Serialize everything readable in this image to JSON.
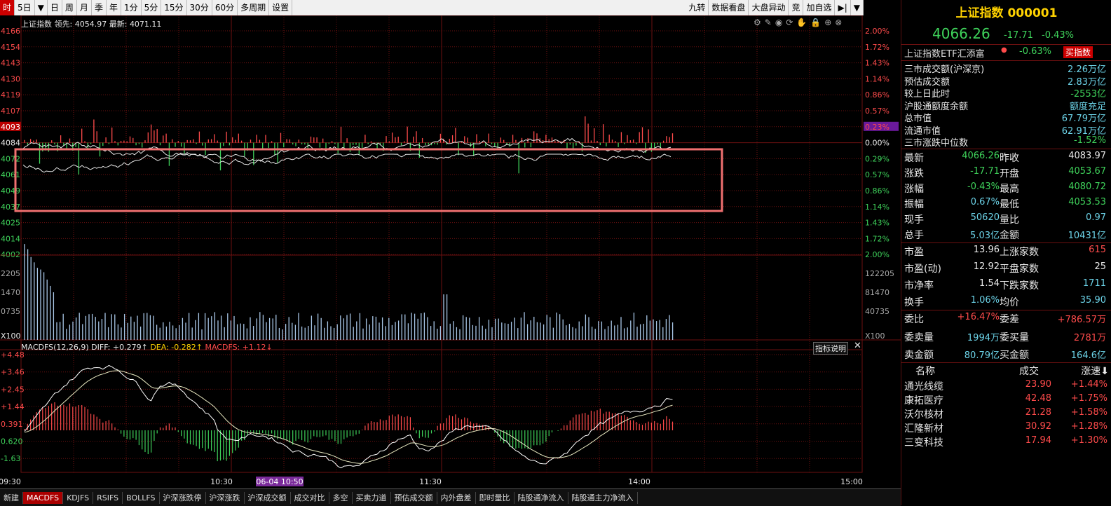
{
  "toolbar": {
    "left_items": [
      "时",
      "5日",
      "▼",
      "日",
      "周",
      "月",
      "季",
      "年",
      "1分",
      "5分",
      "15分",
      "30分",
      "60分",
      "多周期",
      "设置"
    ],
    "right_items": [
      "九转",
      "数据看盘",
      "大盘异动",
      "竞",
      "加自选",
      "▶|",
      "▼"
    ]
  },
  "chart": {
    "info_name": "上证指数",
    "info_lead_label": "领先:",
    "info_lead_value": "4054.97",
    "info_last_label": "最新:",
    "info_last_value": "4071.11",
    "left_price_ticks": [
      "4166",
      "4154",
      "4143",
      "4130",
      "4119",
      "4107",
      "4093",
      "4084",
      "4072",
      "4061",
      "4049",
      "4037",
      "4025",
      "4014",
      "4002"
    ],
    "right_pct_ticks": [
      "2.00%",
      "1.72%",
      "1.43%",
      "1.14%",
      "0.86%",
      "0.57%",
      "0.23%",
      "0.00%",
      "0.29%",
      "0.57%",
      "0.86%",
      "1.14%",
      "1.43%",
      "1.72%",
      "2.00%"
    ],
    "vol_left_ticks": [
      "2205",
      "1470",
      "0735",
      "X100"
    ],
    "vol_right_ticks": [
      "122205",
      "81470",
      "40735",
      "X100"
    ],
    "macd_info_name": "MACDFS(12,26,9)",
    "macd_diff": "DIFF: +0.279↑",
    "macd_dea": "DEA: -0.282↑",
    "macd_val": "MACDFS: +1.12↓",
    "macd_help": "指标说明",
    "macd_ticks": [
      "+4.48",
      "+3.46",
      "+2.45",
      "+1.44",
      "0.391",
      "0.620",
      "-1.63"
    ],
    "time_ticks": [
      "09:30",
      "10:30",
      "11:30",
      "14:00",
      "15:00"
    ],
    "time_cursor": "06-04 10:50",
    "toolbar_icons": [
      "gear",
      "pen",
      "eye",
      "refresh",
      "hand",
      "lock",
      "plus",
      "close"
    ]
  },
  "bottom_tabs": [
    "新建",
    "MACDFS",
    "KDJFS",
    "RSIFS",
    "BOLLFS",
    "沪深涨跌停",
    "沪深涨跌",
    "沪深成交额",
    "成交对比",
    "多空",
    "买卖力道",
    "预估成交额",
    "内外盘差",
    "即时量比",
    "陆股通净流入",
    "陆股通主力净流入"
  ],
  "panel": {
    "title": "上证指数 000001",
    "price": "4066.26",
    "change": "-17.71",
    "change_pct": "-0.43%",
    "etf_name": "上证指数ETF汇添富",
    "etf_pct": "-0.63%",
    "etf_btn": "买指数",
    "stats": [
      {
        "k": "三市成交额(沪深京)",
        "v": "2.26万亿",
        "c": "cy"
      },
      {
        "k": "预估成交额",
        "v": "2.83万亿",
        "c": "cy"
      },
      {
        "k": "较上日此时",
        "v": "-2553亿",
        "c": "grn"
      },
      {
        "k": "沪股通额度余额",
        "v": "额度充足",
        "c": "cy"
      },
      {
        "k": "总市值",
        "v": "67.79万亿",
        "c": "cy"
      },
      {
        "k": "流通市值",
        "v": "62.91万亿",
        "c": "cy"
      },
      {
        "k": "三市涨跌中位数",
        "v": "-1.52%",
        "c": "grn"
      }
    ],
    "quote": [
      {
        "k1": "最新",
        "v1": "4066.26",
        "c1": "grn",
        "k2": "昨收",
        "v2": "4083.97",
        "c2": "wht"
      },
      {
        "k1": "涨跌",
        "v1": "-17.71",
        "c1": "grn",
        "k2": "开盘",
        "v2": "4053.67",
        "c2": "grn"
      },
      {
        "k1": "涨幅",
        "v1": "-0.43%",
        "c1": "grn",
        "k2": "最高",
        "v2": "4080.72",
        "c2": "grn"
      },
      {
        "k1": "振幅",
        "v1": "0.67%",
        "c1": "cy",
        "k2": "最低",
        "v2": "4053.53",
        "c2": "grn"
      },
      {
        "k1": "现手",
        "v1": "50620",
        "c1": "cy",
        "k2": "量比",
        "v2": "0.97",
        "c2": "cy"
      },
      {
        "k1": "总手",
        "v1": "5.03亿",
        "c1": "cy",
        "k2": "金额",
        "v2": "10431亿",
        "c2": "cy"
      }
    ],
    "quote2": [
      {
        "k1": "市盈",
        "v1": "13.96",
        "c1": "wht",
        "k2": "上涨家数",
        "v2": "615",
        "c2": "red"
      },
      {
        "k1": "市盈(动)",
        "v1": "12.92",
        "c1": "wht",
        "k2": "平盘家数",
        "v2": "25",
        "c2": "wht"
      },
      {
        "k1": "市净率",
        "v1": "1.54",
        "c1": "wht",
        "k2": "下跌家数",
        "v2": "1711",
        "c2": "cy"
      },
      {
        "k1": "换手",
        "v1": "1.06%",
        "c1": "cy",
        "k2": "均价",
        "v2": "35.90",
        "c2": "cy"
      }
    ],
    "quote3": [
      {
        "k1": "委比",
        "v1": "+16.47%",
        "c1": "red",
        "k2": "委差",
        "v2": "+786.57万",
        "c2": "red"
      },
      {
        "k1": "委卖量",
        "v1": "1994万",
        "c1": "cy",
        "k2": "委买量",
        "v2": "2781万",
        "c2": "red"
      },
      {
        "k1": "卖金额",
        "v1": "80.79亿",
        "c1": "cy",
        "k2": "买金额",
        "v2": "164.6亿",
        "c2": "cy"
      }
    ],
    "list_header": [
      "名称",
      "成交",
      "涨速⬇"
    ],
    "list": [
      {
        "n": "通光线缆",
        "p": "23.90",
        "s": "+1.44%"
      },
      {
        "n": "康拓医疗",
        "p": "42.48",
        "s": "+1.75%"
      },
      {
        "n": "沃尔核材",
        "p": "21.28",
        "s": "+1.58%"
      },
      {
        "n": "汇隆新材",
        "p": "30.92",
        "s": "+1.28%"
      },
      {
        "n": "三变科技",
        "p": "17.94",
        "s": "+1.30%"
      }
    ]
  },
  "colors": {
    "up": "#ff4b4b",
    "down": "#3fd35b",
    "line": "#e8e8e8",
    "grid": "#6b1010",
    "highlight_box": "#f07070"
  }
}
